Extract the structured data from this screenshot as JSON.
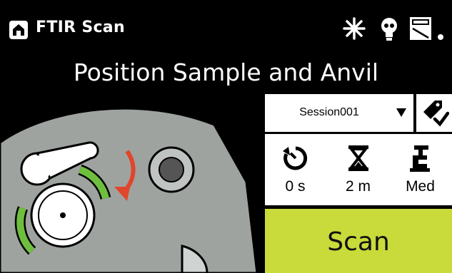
{
  "header": {
    "app_title": "FTIR Scan",
    "page_title": "Position Sample and Anvil",
    "icons": [
      "home-icon",
      "light-icon",
      "bulb-icon",
      "battery-icon"
    ]
  },
  "session": {
    "selected": "Session001",
    "icon": "chevron-down-icon"
  },
  "tag": {
    "icon": "tag-check-icon"
  },
  "settings": [
    {
      "name": "delay",
      "icon": "timer-icon",
      "value": "0 s"
    },
    {
      "name": "duration",
      "icon": "hourglass-icon",
      "value": "2 m"
    },
    {
      "name": "pressure",
      "icon": "anvil-icon",
      "value": "Med"
    }
  ],
  "scan": {
    "label": "Scan"
  },
  "colors": {
    "background": "#000000",
    "scan_button": "#c9db3a",
    "panel": "#ffffff",
    "instrument": "#9ea3a0",
    "arrow": "#e0462b",
    "ring_indicator": "#6fbf3f"
  }
}
